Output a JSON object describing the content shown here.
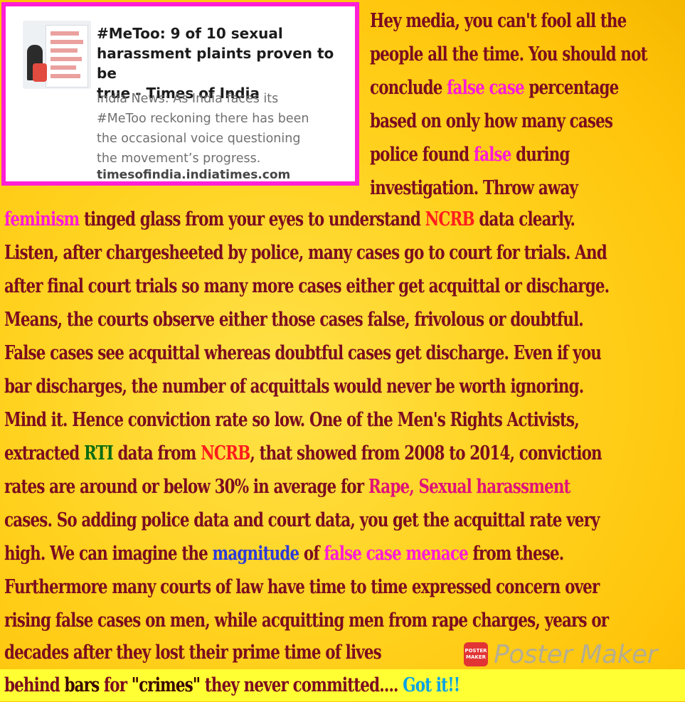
{
  "card": {
    "title_lines": [
      "#MeToo: 9 of 10 sexual",
      "harassment plaints proven to be",
      "true - Times of India"
    ],
    "description_lines": [
      "India News: As India faces its",
      "#MeToo reckoning there has been",
      "the occasional voice questioning",
      "the movement’s progress."
    ],
    "domain": "timesofindia.indiatimes.com"
  },
  "body": {
    "l1": "Hey media, you can't fool all the",
    "l2": "people all the time. You should not",
    "l3a": "conclude ",
    "l3b": "false case",
    "l3c": " percentage",
    "l4": "based on only how many cases",
    "l5a": "police found ",
    "l5b": "false",
    "l5c": " during",
    "l6": "investigation. Throw away",
    "l7a": "feminism",
    "l7b": " tinged glass from your eyes to understand ",
    "l7c": "NCRB",
    "l7d": " data clearly.",
    "l8": "Listen, after chargesheeted by police, many cases go to court for trials. And",
    "l9": "after final court trials so many more cases either get acquittal or discharge.",
    "l10": "Means, the courts observe either those cases false, frivolous or doubtful.",
    "l11": "False cases see acquittal whereas doubtful cases get discharge. Even if you",
    "l12": "bar discharges, the number of acquittals would never be worth ignoring.",
    "l13": "Mind it. Hence conviction rate so low. One of the Men's Rights Activists,",
    "l14a": "extracted ",
    "l14b": "RTI",
    "l14c": " data from ",
    "l14d": "NCRB",
    "l14e": ", that showed from 2008 to 2014, conviction",
    "l15a": "rates are around or below 30% in average for ",
    "l15b": "Rape, Sexual harassment",
    "l16": "cases. So adding police data and court data, you get the acquittal rate very",
    "l17a": "high. We can imagine the ",
    "l17b": "magnitude",
    "l17c": " of ",
    "l17d": "false case menace",
    "l17e": " from these.",
    "l18": "Furthermore many courts of law have time to time expressed concern over",
    "l19": "rising false cases on men, while acquitting men from rape charges, years or",
    "l20": "decades after they lost their prime time of lives",
    "l21a": "behind ",
    "l21b": "bars",
    "l21c": " for ",
    "l21d": "\"crimes\"",
    "l21e": " they never committed.... ",
    "l21f": "Got it!!"
  },
  "watermark": {
    "text": "Poster Maker",
    "logo_text": "POSTER MAKER"
  },
  "colors": {
    "background": "#ffd21f",
    "text": "#7b0c1f",
    "card_border": "#ff1fd6",
    "pink": "#ff1ad9",
    "red": "#ff1c1c",
    "green": "#0b6b12",
    "blue": "#2c39d8",
    "cyan": "#0aa2e6",
    "strip": "#ffff33"
  }
}
